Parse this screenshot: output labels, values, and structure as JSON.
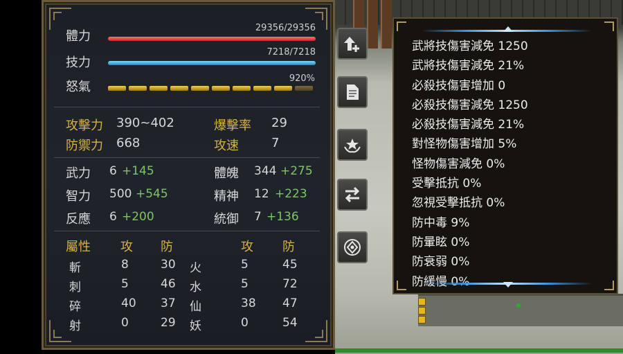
{
  "bars": {
    "hp": {
      "label": "體力",
      "value": "29356/29356",
      "fraction": 1.0
    },
    "mp": {
      "label": "技力",
      "value": "7218/7218",
      "fraction": 1.0
    },
    "rage": {
      "label": "怒氣",
      "value": "920%",
      "segments_total": 10,
      "segments_filled": 9
    }
  },
  "combat": [
    {
      "label": "攻擊力",
      "value": "390~402"
    },
    {
      "label": "防禦力",
      "value": "668"
    },
    {
      "label": "爆擊率",
      "value": "29"
    },
    {
      "label": "攻速",
      "value": "7"
    }
  ],
  "attributes": [
    {
      "label": "武力",
      "base": "6",
      "bonus": "+145"
    },
    {
      "label": "智力",
      "base": "500",
      "bonus": "+545"
    },
    {
      "label": "反應",
      "base": "6",
      "bonus": "+200"
    },
    {
      "label": "體魄",
      "base": "344",
      "bonus": "+275"
    },
    {
      "label": "精神",
      "base": "12",
      "bonus": "+223"
    },
    {
      "label": "統御",
      "base": "7",
      "bonus": "+136"
    }
  ],
  "elements": {
    "header": {
      "label": "屬性",
      "atk": "攻",
      "def": "防",
      "atk2": "攻",
      "def2": "防"
    },
    "rows": [
      {
        "a": "斬",
        "a_atk": "8",
        "a_def": "30",
        "b": "火",
        "b_atk": "5",
        "b_def": "45"
      },
      {
        "a": "刺",
        "a_atk": "5",
        "a_def": "46",
        "b": "水",
        "b_atk": "5",
        "b_def": "72"
      },
      {
        "a": "碎",
        "a_atk": "40",
        "a_def": "37",
        "b": "仙",
        "b_atk": "38",
        "b_def": "47"
      },
      {
        "a": "射",
        "a_atk": "0",
        "a_def": "29",
        "b": "妖",
        "b_atk": "0",
        "b_def": "54"
      }
    ]
  },
  "toolbar": [
    {
      "icon": "level-up-icon"
    },
    {
      "icon": "document-icon"
    },
    {
      "icon": "emblem-icon"
    },
    {
      "icon": "swap-icon"
    },
    {
      "icon": "compass-icon"
    }
  ],
  "tooltip": {
    "lines": [
      "武將技傷害減免 1250",
      "武將技傷害減免 21%",
      "必殺技傷害增加 0",
      "必殺技傷害減免 1250",
      "必殺技傷害減免 21%",
      "對怪物傷害增加 5%",
      "怪物傷害減免 0%",
      "受擊抵抗 0%",
      "忽視受擊抵抗 0%",
      "防中毒 9%",
      "防暈眩 0%",
      "防衰弱 0%",
      "防緩慢 0%"
    ]
  }
}
